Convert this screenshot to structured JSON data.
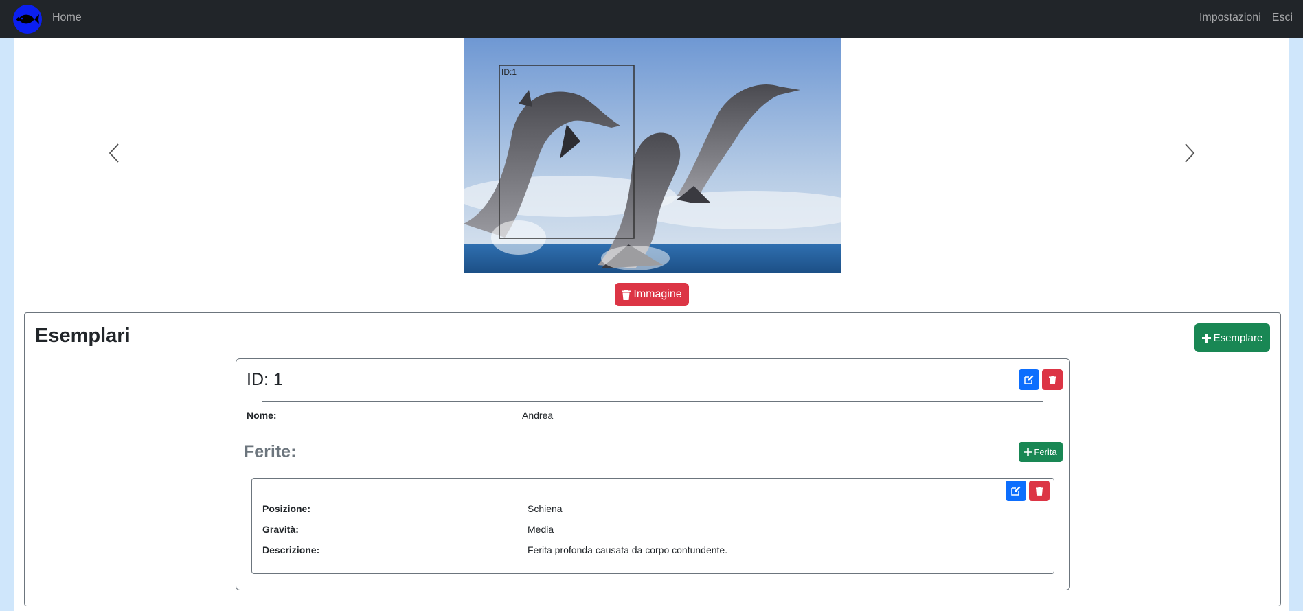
{
  "navbar": {
    "logo_icon": "fish-logo-icon",
    "home_label": "Home",
    "settings_label": "Impostazioni",
    "logout_label": "Esci"
  },
  "carousel": {
    "prev_icon": "chevron-left-icon",
    "next_icon": "chevron-right-icon",
    "detection_label": "ID:1"
  },
  "delete_image_button": {
    "icon": "trash-icon",
    "label": "Immagine"
  },
  "esemplari": {
    "title": "Esemplari",
    "add_button_label": "Esemplare",
    "add_button_icon": "plus-icon",
    "items": [
      {
        "title": "ID: 1",
        "edit_icon": "edit-icon",
        "delete_icon": "trash-icon",
        "name_label": "Nome:",
        "name_value": "Andrea",
        "ferite_title": "Ferite:",
        "add_ferita_label": "Ferita",
        "ferite": [
          {
            "position_label": "Posizione:",
            "position_value": "Schiena",
            "severity_label": "Gravità:",
            "severity_value": "Media",
            "description_label": "Descrizione:",
            "description_value": "Ferita profonda causata da corpo contundente."
          }
        ]
      }
    ]
  },
  "colors": {
    "navbar_bg": "#212529",
    "page_bg": "#cfe6fb",
    "danger": "#dc3545",
    "success": "#198754",
    "primary": "#0d6efd",
    "logo": "#0b1ff0"
  }
}
